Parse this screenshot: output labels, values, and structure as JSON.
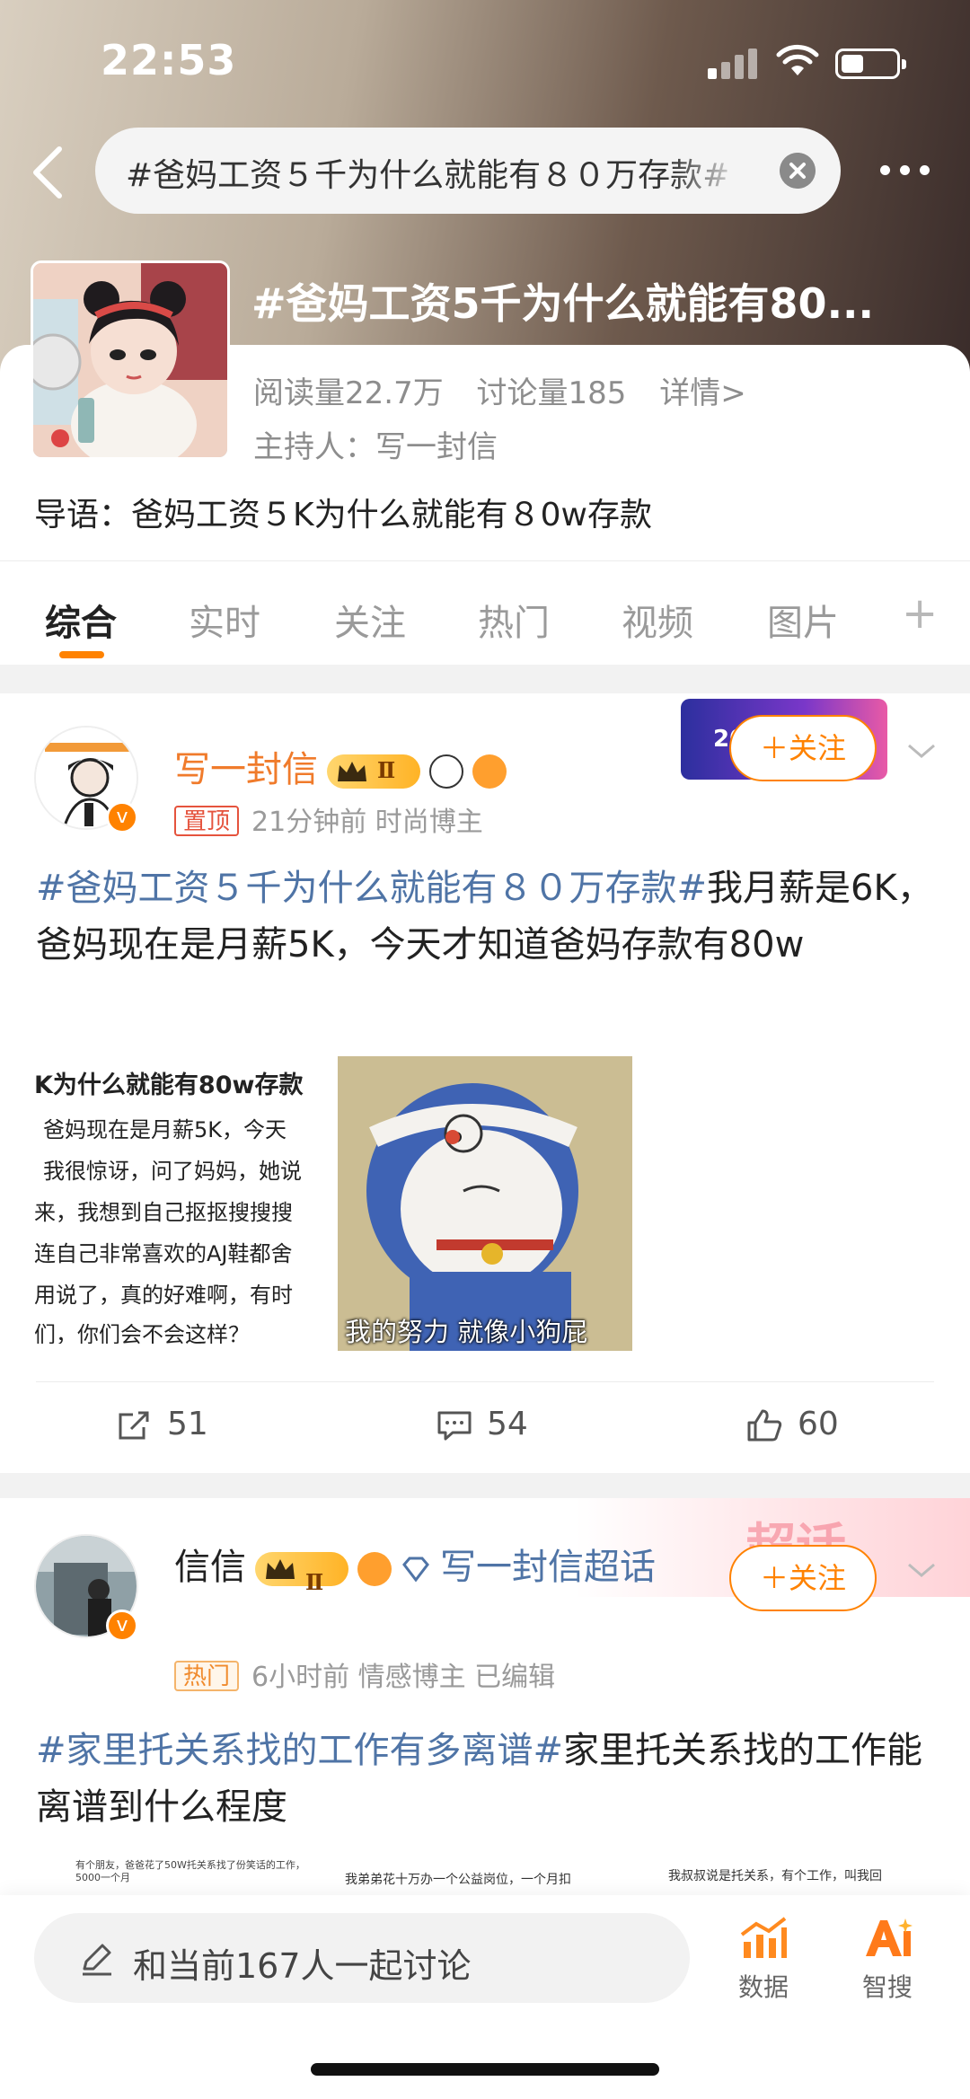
{
  "status_bar": {
    "time": "22:53"
  },
  "search": {
    "query": "#爸妈工资５千为什么就能有８０万存款#"
  },
  "topic": {
    "title": "#爸妈工资5千为什么就能有80...",
    "reads": "阅读量22.7万",
    "discussions": "讨论量185",
    "details_link": "详情>",
    "host": "主持人：写一封信",
    "intro": "导语：爸妈工资５K为什么就能有８0w存款"
  },
  "tabs": [
    {
      "label": "综合",
      "active": true
    },
    {
      "label": "实时"
    },
    {
      "label": "关注"
    },
    {
      "label": "热门"
    },
    {
      "label": "视频"
    },
    {
      "label": "图片"
    }
  ],
  "posts": [
    {
      "username": "写一封信",
      "level": "Ⅱ",
      "tag": "置顶",
      "meta": "21分钟前  时尚博主",
      "follow_label": "＋关注",
      "hashtag": "#爸妈工资５千为什么就能有８０万存款#",
      "text": "我月薪是6K，爸妈现在是月薪5K，今天才知道爸妈存款有80w",
      "image1_lines": [
        "K为什么就能有80w存款",
        "爸妈现在是月薪5K，今天",
        "我很惊讶，问了妈妈，她说",
        "来，我想到自己抠抠搜搜搜",
        "连自己非常喜欢的AJ鞋都舍",
        "用说了，真的好难啊，有时",
        "们，你们会不会这样？"
      ],
      "image2_caption": "我的努力 就像小狗屁",
      "banner_text": "2022",
      "reposts": "51",
      "comments": "54",
      "likes": "60"
    },
    {
      "username": "信信",
      "level": "Ⅱ",
      "super_topic": "写一封信超话",
      "tag": "热门",
      "meta": "6小时前  情感博主  已编辑",
      "follow_label": "＋关注",
      "banner_text": "超话",
      "hashtag": "#家里托关系找的工作有多离谱#",
      "text": "家里托关系找的工作能离谱到什么程度",
      "preview_snippets": [
        "我弟弟花十万办一个公益岗位，一个月扣",
        "我叔叔说是托关系，有个工作，叫我回",
        "有个朋友，爸爸花了50W托关系找了份笑话的工作，5000一个月"
      ]
    }
  ],
  "bottom_bar": {
    "discuss_placeholder": "和当前167人一起讨论",
    "data_label": "数据",
    "smart_search_label": "智搜"
  }
}
